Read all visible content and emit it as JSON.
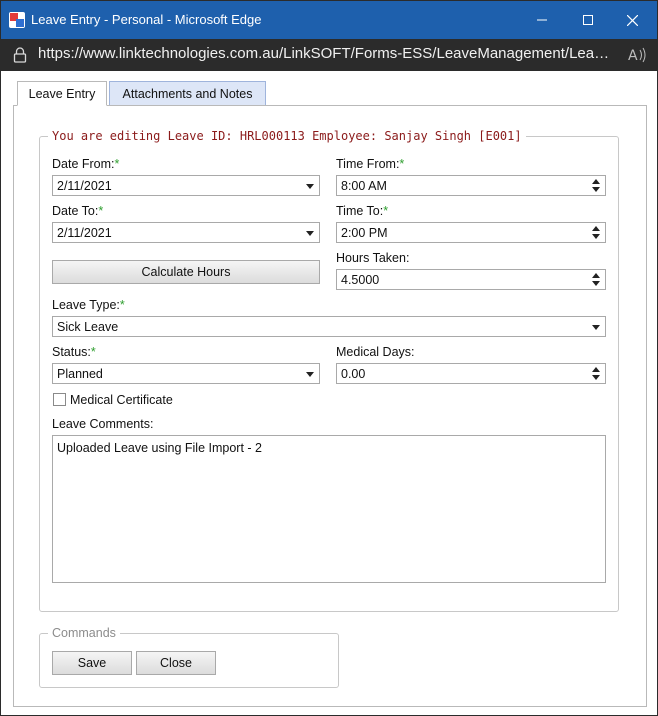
{
  "window": {
    "title": "Leave Entry - Personal - Microsoft Edge",
    "url": "https://www.linktechnologies.com.au/LinkSOFT/Forms-ESS/LeaveManagement/LeaveEntryP..."
  },
  "tabs": [
    {
      "label": "Leave Entry",
      "active": true
    },
    {
      "label": "Attachments and Notes",
      "active": false
    }
  ],
  "form": {
    "legend": "You are editing Leave ID: HRL000113 Employee: Sanjay Singh [E001]",
    "required_mark": "*",
    "date_from_label": "Date From:",
    "date_from_value": "2/11/2021",
    "time_from_label": "Time From:",
    "time_from_value": "8:00 AM",
    "date_to_label": "Date To:",
    "date_to_value": "2/11/2021",
    "time_to_label": "Time To:",
    "time_to_value": "2:00 PM",
    "calculate_label": "Calculate Hours",
    "hours_taken_label": "Hours Taken:",
    "hours_taken_value": "4.5000",
    "leave_type_label": "Leave Type:",
    "leave_type_value": "Sick Leave",
    "status_label": "Status:",
    "status_value": "Planned",
    "medical_days_label": "Medical Days:",
    "medical_days_value": "0.00",
    "medical_certificate_label": "Medical Certificate",
    "medical_certificate_checked": false,
    "comments_label": "Leave Comments:",
    "comments_value": "Uploaded Leave using File Import - 2"
  },
  "commands": {
    "legend": "Commands",
    "save_label": "Save",
    "close_label": "Close"
  },
  "colors": {
    "titlebar": "#1e60ad",
    "required": "#2e9e2e",
    "legend_text": "#8b1a1a",
    "inactive_tab": "#dde6f7"
  }
}
